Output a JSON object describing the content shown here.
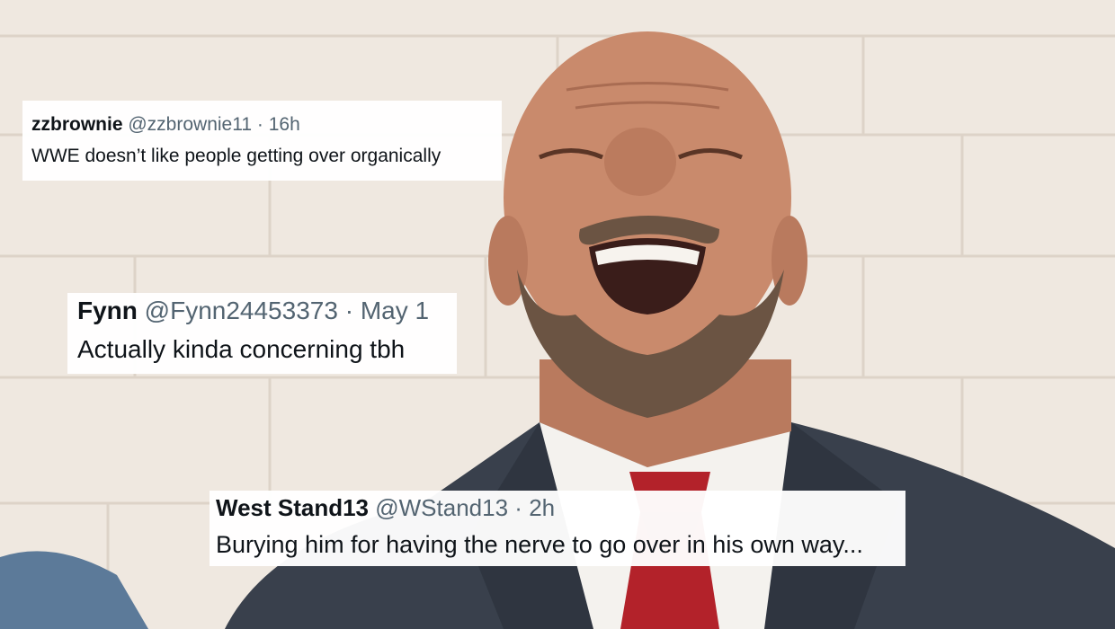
{
  "image": {
    "subject": "photo-of-laughing-man-in-suit",
    "colors": {
      "wall": "#efe8e0",
      "suit": "#39404c",
      "tie": "#b3222a",
      "skin": "#c98a6c",
      "beard": "#6b5443"
    }
  },
  "tweets": [
    {
      "name": "zzbrownie",
      "handle": "@zzbrownie11",
      "sep": "·",
      "time": "16h",
      "text": "WWE doesn’t like people getting over organically"
    },
    {
      "name": "Fynn",
      "handle": "@Fynn24453373",
      "sep": "·",
      "time": "May 1",
      "text": "Actually kinda concerning tbh"
    },
    {
      "name": "West Stand13",
      "handle": "@WStand13",
      "sep": "·",
      "time": "2h",
      "text": "Burying him for having the nerve to go over in his own way..."
    }
  ]
}
